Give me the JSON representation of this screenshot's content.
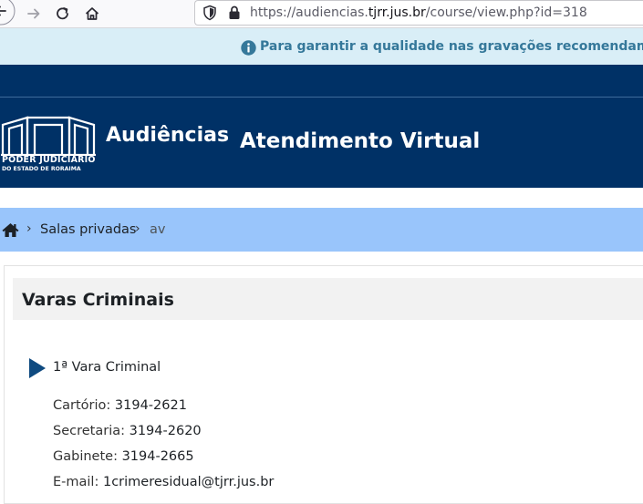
{
  "browser": {
    "url_prefix": "https://audiencias.",
    "url_host": "tjrr.jus.br",
    "url_path": "/course/view.php?id=318"
  },
  "notice": {
    "text": "Para garantir a qualidade nas gravações recomendamos fortemente o uso do navegador Google Chrome"
  },
  "header": {
    "logo_line1": "PODER JUDICIÁRIO",
    "logo_line2": "DO ESTADO DE RORAIMA",
    "brand": "Audiências",
    "site_title": "Atendimento Virtual"
  },
  "breadcrumb": {
    "items": [
      "Salas privadas",
      "av"
    ]
  },
  "section": {
    "title": "Varas Criminais",
    "activity": {
      "title": "1ª Vara Criminal",
      "lines": [
        {
          "label": "Cartório:",
          "value": "3194-2621"
        },
        {
          "label": "Secretaria:",
          "value": "3194-2620"
        },
        {
          "label": "Gabinete:",
          "value": "3194-2665"
        },
        {
          "label": "E-mail:",
          "value": "1crimeresidual@tjrr.jus.br"
        }
      ]
    }
  },
  "colors": {
    "header_bg": "#003166",
    "breadcrumb_bg": "#99c5fb",
    "notice_bg": "#d9eef7",
    "notice_text": "#35789a"
  },
  "icons": {
    "back": "arrow-left-icon",
    "forward": "arrow-right-icon",
    "reload": "reload-icon",
    "home": "home-icon",
    "shield": "shield-icon",
    "lock": "lock-icon",
    "info": "info-icon",
    "breadcrumb_home": "home-icon",
    "activity": "play-icon"
  }
}
